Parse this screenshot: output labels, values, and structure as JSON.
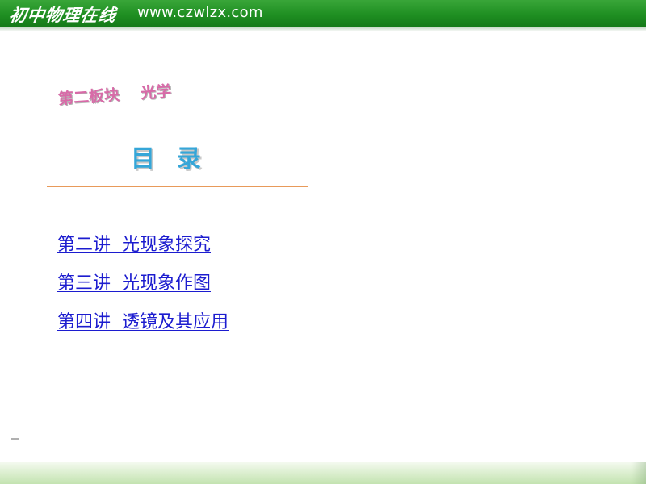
{
  "header": {
    "calligraphy_title": "初中物理在线",
    "site_url": "www.czwlzx.com"
  },
  "content": {
    "section_title": "第二板块    光学",
    "toc_heading": "目  录",
    "links": [
      "第二讲  光现象探究",
      "第三讲  光现象作图",
      "第四讲  透镜及其应用"
    ]
  },
  "colors": {
    "header_green": "#1f8f22",
    "section_title_pink": "#d86aa8",
    "toc_heading_blue": "#35a6d8",
    "divider_orange": "#e89a5a",
    "link_blue": "#1c1ccf"
  }
}
